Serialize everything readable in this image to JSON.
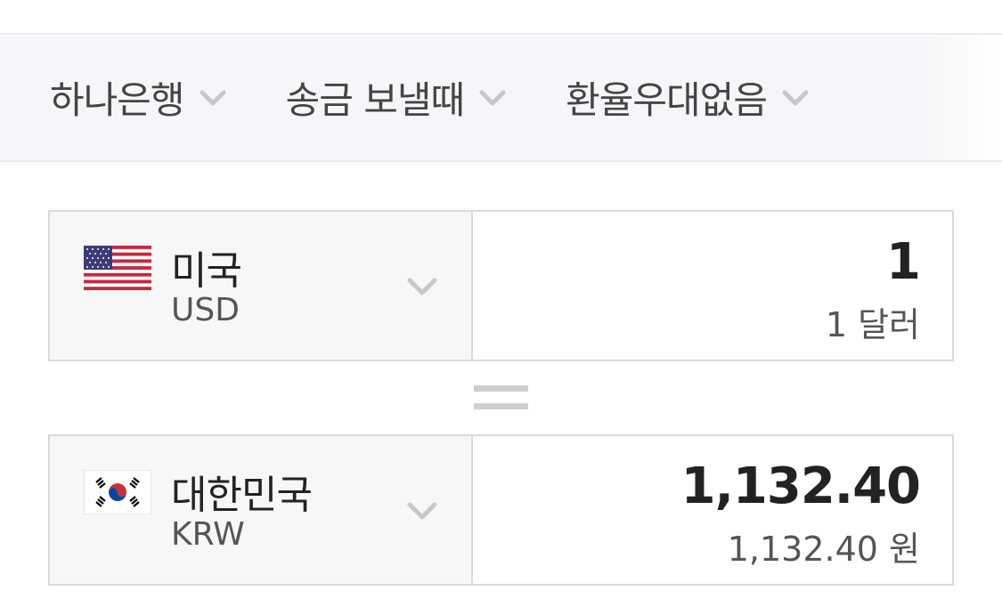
{
  "filters": [
    {
      "label": "하나은행",
      "icon": "chevron-down-icon"
    },
    {
      "label": "송금 보낼때",
      "icon": "chevron-down-icon"
    },
    {
      "label": "환율우대없음",
      "icon": "chevron-down-icon"
    }
  ],
  "from": {
    "flag": "us-flag-icon",
    "name": "미국",
    "code": "USD",
    "amount": "1",
    "amount_words": "1 달러"
  },
  "to": {
    "flag": "kr-flag-icon",
    "name": "대한민국",
    "code": "KRW",
    "amount": "1,132.40",
    "amount_words": "1,132.40 원"
  },
  "colors": {
    "filter_bg": "#f4f6f9",
    "select_bg": "#f7f7f7",
    "border": "#dadada",
    "chevron": "#c8c8c8"
  }
}
